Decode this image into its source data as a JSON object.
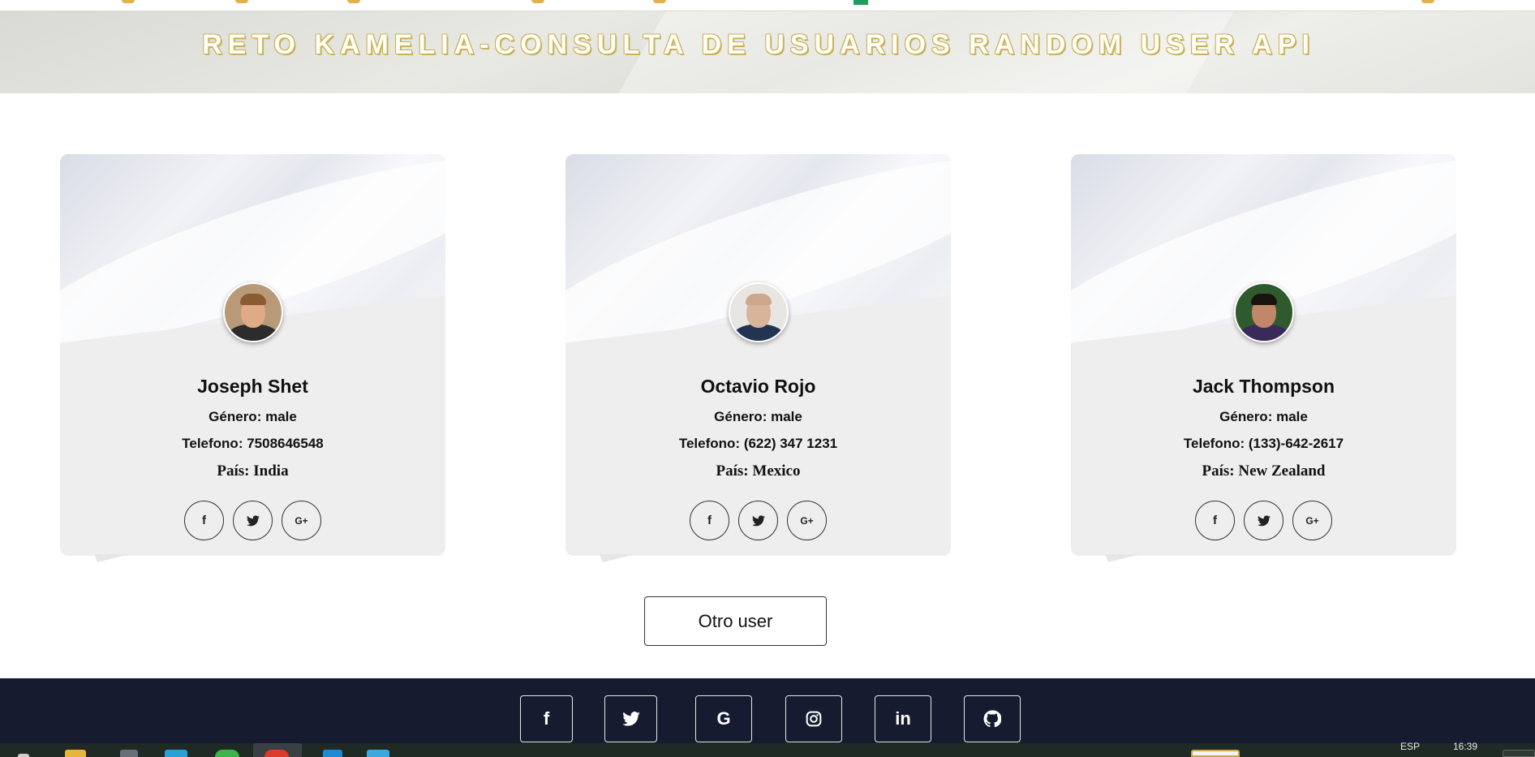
{
  "header": {
    "title": "RETO KAMELIA-CONSULTA DE USUARIOS RANDOM USER API"
  },
  "users": [
    {
      "name": "Joseph Shet",
      "gender": "Género: male",
      "phone": "Telefono: 7508646548",
      "country": "País: India"
    },
    {
      "name": "Octavio Rojo",
      "gender": "Género: male",
      "phone": "Telefono: (622) 347 1231",
      "country": "País: Mexico"
    },
    {
      "name": "Jack Thompson",
      "gender": "Género: male",
      "phone": "Telefono: (133)-642-2617",
      "country": "País: New Zealand"
    }
  ],
  "card_socials": {
    "facebook": "f",
    "twitter": "twitter-icon",
    "googleplus": "G+"
  },
  "actions": {
    "another_user": "Otro user"
  },
  "footer": {
    "icons": [
      "facebook-icon",
      "twitter-icon",
      "google-icon",
      "instagram-icon",
      "linkedin-icon",
      "github-icon"
    ],
    "labels": {
      "facebook": "f",
      "google": "G",
      "linkedin": "in"
    }
  },
  "taskbar": {
    "language": "ESP",
    "time": "16:39"
  },
  "colors": {
    "footer_bg": "#161b30",
    "title_outline": "#c9b25a",
    "card_bg": "#eeeeee"
  }
}
